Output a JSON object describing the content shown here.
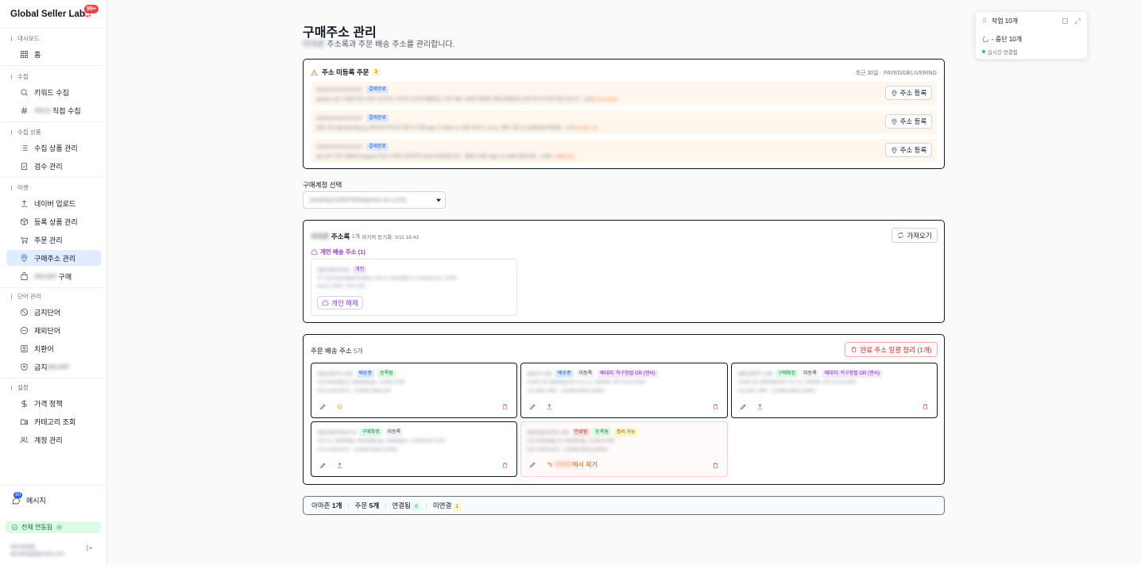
{
  "sidebar": {
    "brand": "Global Seller Lab",
    "notification_count": "99+",
    "sections": [
      {
        "label": "대시보드",
        "items": [
          {
            "label": "홈",
            "icon": "grid-icon"
          }
        ]
      },
      {
        "label": "수집",
        "items": [
          {
            "label": "키워드 수집",
            "icon": "search-icon"
          },
          {
            "label": "직접 수집",
            "blur_prefix": "Abcd",
            "icon": "hash-icon"
          }
        ]
      },
      {
        "label": "수집 상품",
        "items": [
          {
            "label": "수집 상품 관리",
            "icon": "list-icon"
          },
          {
            "label": "검수 관리",
            "icon": "clipboard-check-icon"
          }
        ]
      },
      {
        "label": "마켓",
        "items": [
          {
            "label": "네이버 업로드",
            "icon": "upload-icon"
          },
          {
            "label": "등록 상품 관리",
            "icon": "box-icon"
          },
          {
            "label": "주문 관리",
            "icon": "cart-icon"
          },
          {
            "label": "구매주소 관리",
            "icon": "map-pin-icon",
            "active": true
          },
          {
            "label": "구매",
            "blur_prefix": "Abcdef",
            "icon": "bag-icon"
          }
        ]
      },
      {
        "label": "단어 관리",
        "items": [
          {
            "label": "금지단어",
            "icon": "ban-icon"
          },
          {
            "label": "제외단어",
            "icon": "minus-circle-icon"
          },
          {
            "label": "치환어",
            "icon": "replace-icon"
          },
          {
            "label": "금지",
            "blur_suffix": "abcdef",
            "icon": "shield-icon"
          }
        ]
      },
      {
        "label": "설정",
        "items": [
          {
            "label": "가격 정책",
            "icon": "dollar-icon"
          },
          {
            "label": "카테고리 조회",
            "icon": "folder-search-icon"
          },
          {
            "label": "계정 관리",
            "icon": "users-icon"
          }
        ]
      }
    ],
    "messages_label": "메시지",
    "messages_count": "30",
    "sync_label": "전체 연동됨",
    "user_blur_1": "Abcdefgh",
    "user_blur_2": "abcdefg@gmail.com"
  },
  "page": {
    "title": "구매주소 관리",
    "subtitle_blur": "아마존",
    "subtitle": "주소록과 주문 배송 주소를 관리합니다."
  },
  "unregistered": {
    "title": "주소 미등록 주문",
    "count": "3",
    "meta": "최근 30일 · PAYED/DELIVERING",
    "register_label": "주소 등록",
    "rows": [
      {
        "id": "2024XXXXXXXXXX",
        "status": "결제완료",
        "detail": "abcdef 12/1 가열하 청소 제거 유지하는 처리와 도미의 배열하는 거의 제수 사용한 결제된 최대 결제완료 상세 주소의 등록 필요 합니다 · 2025",
        "price": "4,870,000"
      },
      {
        "id": "2024XXXXXXXXXX",
        "status": "결제완료",
        "detail": "제일 가선 abcdef deep.jp (문자)의 하다로 착용 수 연결 ppp-17 @ke.co 선물 라지오, ce ku, 제주 기본 12-3456789 배송을 · 4,7%",
        "price": "5,620,711"
      },
      {
        "id": "2024XXXXXXXXXX",
        "status": "결제완료",
        "detail": "abt 10/7 리다 정물의 kangsoo 최신 소재의 인천지역 2024 대리원입니다 · 결제사 제안 high 12-3456 배송요청 · 2,900",
        "price": "7,880,000"
      }
    ]
  },
  "account": {
    "label": "구매계정 선택",
    "value": "abcdefg1234567890@gmail.com (123)"
  },
  "addressbook": {
    "title_blur": "아마존",
    "title": "주소록",
    "count": "1개",
    "sync": "마지막 동기화: 3/11 18:43",
    "import_label": "가져오기",
    "personal_header": "개인 배송 주소 (1)",
    "card": {
      "name": "ABCDEFGHIJ",
      "tag": "개인",
      "line1": "7F, 1234 Abcdefghij Building, 123-12, Abcdefgh-ro, Gangnam-gu, 12345",
      "line2": "Seoul, 12345 · 010-1234",
      "release_label": "개인 해제"
    }
  },
  "orders": {
    "title": "주문 배송 주소",
    "count": "5개",
    "cleanup_label": "완료 주소 일괄 정리 (1개)",
    "cards": [
      {
        "name": "ABCDEFG LEE",
        "tags": [
          {
            "t": "배송중",
            "c": "blue"
          },
          {
            "t": "등록됨",
            "c": "green"
          }
        ],
        "l1": "123 Abcdefg-ro, Abcdefg-gu, 12345-6789",
        "l2": "010-1234-5678 · 12345678901234",
        "acts": [
          "edit",
          "unlink"
        ],
        "style": "normal"
      },
      {
        "name": "ABCD LEE",
        "tags": [
          {
            "t": "배송중",
            "c": "blue"
          },
          {
            "t": "미등록",
            "c": "gray"
          },
          {
            "t": "배대지: 직구창렬 OR (엔씨)",
            "c": "purple"
          }
        ],
        "l1": "12345 SE Abcdefg Ave STE 12, Abcdef, OR 97123-4567",
        "l2": "123-456-7890 · 12345678901234567",
        "acts": [
          "edit",
          "upload"
        ],
        "style": "normal"
      },
      {
        "name": "ABCDEFG LIM",
        "tags": [
          {
            "t": "구매확정",
            "c": "green"
          },
          {
            "t": "미등록",
            "c": "gray"
          },
          {
            "t": "배대지: 직구창렬 OR (엔씨)",
            "c": "purple"
          }
        ],
        "l1": "12345 SE Abcdefg Ave STE 12, Abcdef, OR 97123-4567",
        "l2": "123-456-7890 · 12345678901234567",
        "acts": [
          "edit",
          "upload"
        ],
        "style": "normal"
      },
      {
        "name": "ABCDEFGHIJ IN",
        "tags": [
          {
            "t": "구매확정",
            "c": "green"
          },
          {
            "t": "미등록",
            "c": "gray"
          }
        ],
        "l1": "123-12, Abcdefgh, Abcdefgh-gu, Abcdefg-si, 12345678-1234",
        "l2": "123-1234-5678 · 12345678901234567",
        "acts": [
          "edit",
          "upload"
        ],
        "style": "normal"
      },
      {
        "name": "ABCDEFGHIJ JIN",
        "tags": [
          {
            "t": "만료됨",
            "c": "red"
          },
          {
            "t": "등록됨",
            "c": "green"
          },
          {
            "t": "정리 가능",
            "c": "yellow"
          }
        ],
        "l1": "123 Abcdefgh-ro, Abcdef-gu, 12345-6789",
        "l2": "010-1234-5678 · 12345678901234567",
        "acts": [
          "edit"
        ],
        "remove_blur": "아마존",
        "remove_label": "에서 제거",
        "style": "faded"
      }
    ]
  },
  "footer": {
    "amazon": "아마존",
    "amazon_count": "1개",
    "orders": "주문",
    "orders_count": "5개",
    "linked": "연결됨",
    "linked_count": "0",
    "unlinked": "미연결",
    "unlinked_count": "1"
  },
  "task": {
    "title": "작업 10개",
    "line": "- 중단 10개",
    "status": "실시간 연결됨"
  },
  "colors": {
    "accent": "#2563eb",
    "warning": "#ea580c",
    "danger": "#ef4444",
    "purple": "#9333ea"
  }
}
